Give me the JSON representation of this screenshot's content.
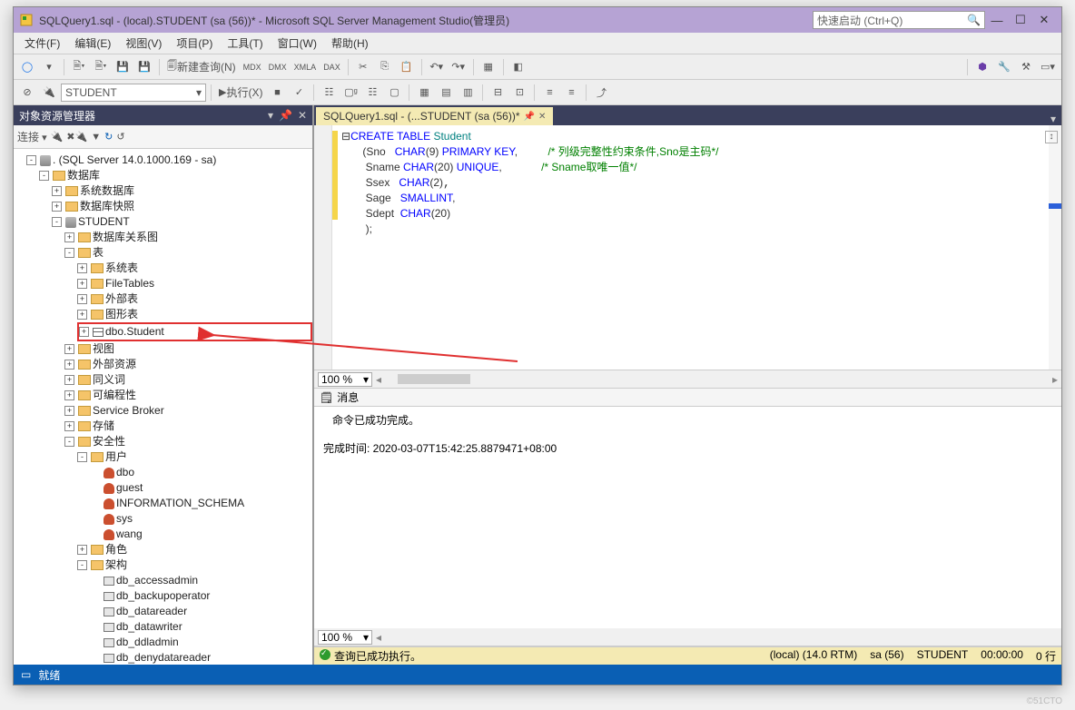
{
  "title": "SQLQuery1.sql - (local).STUDENT (sa (56))* - Microsoft SQL Server Management Studio(管理员)",
  "quicklaunch": {
    "placeholder": "快速启动 (Ctrl+Q)"
  },
  "menu": {
    "items": [
      "文件(F)",
      "编辑(E)",
      "视图(V)",
      "项目(P)",
      "工具(T)",
      "窗口(W)",
      "帮助(H)"
    ]
  },
  "toolbar1": {
    "newquery": "新建查询(N)"
  },
  "toolbar2": {
    "db": "STUDENT",
    "execute": "执行(X)"
  },
  "objectExplorer": {
    "title": "对象资源管理器",
    "connect": "连接",
    "root": ". (SQL Server 14.0.1000.169 - sa)",
    "nodes": {
      "databases": "数据库",
      "sysdb": "系统数据库",
      "snapshots": "数据库快照",
      "student": "STUDENT",
      "diagrams": "数据库关系图",
      "tables": "表",
      "systables": "系统表",
      "filetables": "FileTables",
      "externaltables": "外部表",
      "graphtables": "图形表",
      "dbostudent": "dbo.Student",
      "views": "视图",
      "extresources": "外部资源",
      "synonyms": "同义词",
      "programmability": "可编程性",
      "servicebroker": "Service Broker",
      "storage": "存储",
      "security": "安全性",
      "users": "用户",
      "u_dbo": "dbo",
      "u_guest": "guest",
      "u_info": "INFORMATION_SCHEMA",
      "u_sys": "sys",
      "u_wang": "wang",
      "roles": "角色",
      "schemas": "架构",
      "s1": "db_accessadmin",
      "s2": "db_backupoperator",
      "s3": "db_datareader",
      "s4": "db_datawriter",
      "s5": "db_ddladmin",
      "s6": "db_denydatareader"
    }
  },
  "editorTab": {
    "label": "SQLQuery1.sql - (...STUDENT (sa (56))*"
  },
  "sql": {
    "l1a": "CREATE",
    "l1b": " TABLE",
    "l1c": " Student",
    "l2a": "       (Sno   ",
    "l2b": "CHAR",
    "l2c": "(9) ",
    "l2d": "PRIMARY",
    "l2e": " KEY",
    "l2f": ",",
    "l2cm": "          /* 列级完整性约束条件,Sno是主码*/",
    "l3a": "        Sname ",
    "l3b": "CHAR",
    "l3c": "(20) ",
    "l3d": "UNIQUE",
    "l3e": ",",
    "l3cm": "             /* Sname取唯一值*/",
    "l4a": "        Ssex   ",
    "l4b": "CHAR",
    "l4c": "(2)",
    ",l4d": ",",
    "l5a": "        Sage   ",
    "l5b": "SMALLINT",
    "l5c": ",",
    "l6a": "        Sdept  ",
    "l6b": "CHAR",
    "l6c": "(20)",
    "l7": "        );"
  },
  "zoom1": "100 %",
  "messages": {
    "tab": "消息",
    "line1": "命令已成功完成。",
    "line2": "完成时间: 2020-03-07T15:42:25.8879471+08:00"
  },
  "zoom2": "100 %",
  "editorStatus": {
    "ok": "查询已成功执行。",
    "server": "(local) (14.0 RTM)",
    "user": "sa (56)",
    "db": "STUDENT",
    "time": "00:00:00",
    "rows": "0 行"
  },
  "appStatus": "就绪"
}
